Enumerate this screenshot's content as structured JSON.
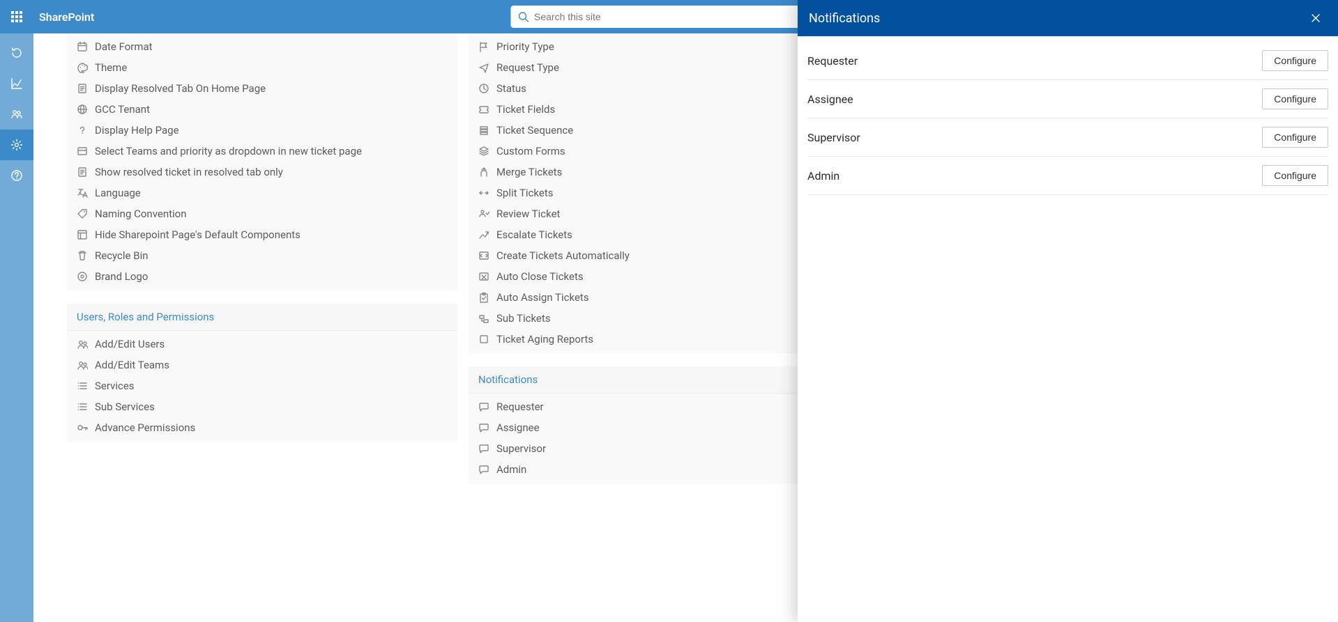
{
  "header": {
    "brand": "SharePoint",
    "search_placeholder": "Search this site"
  },
  "panel": {
    "title": "Notifications",
    "rows": [
      {
        "label": "Requester",
        "action": "Configure"
      },
      {
        "label": "Assignee",
        "action": "Configure"
      },
      {
        "label": "Supervisor",
        "action": "Configure"
      },
      {
        "label": "Admin",
        "action": "Configure"
      }
    ]
  },
  "left_column": {
    "general_items": [
      "Date Format",
      "Theme",
      "Display Resolved Tab On Home Page",
      "GCC Tenant",
      "Display Help Page",
      "Select Teams and priority as dropdown in new ticket page",
      "Show resolved ticket in resolved tab only",
      "Language",
      "Naming Convention",
      "Hide Sharepoint Page's Default Components",
      "Recycle Bin",
      "Brand Logo"
    ],
    "users_header": "Users, Roles and Permissions",
    "users_items": [
      "Add/Edit Users",
      "Add/Edit Teams",
      "Services",
      "Sub Services",
      "Advance Permissions"
    ]
  },
  "right_column": {
    "ticket_items": [
      "Priority Type",
      "Request Type",
      "Status",
      "Ticket Fields",
      "Ticket Sequence",
      "Custom Forms",
      "Merge Tickets",
      "Split Tickets",
      "Review Ticket",
      "Escalate Tickets",
      "Create Tickets Automatically",
      "Auto Close Tickets",
      "Auto Assign Tickets",
      "Sub Tickets",
      "Ticket Aging Reports"
    ],
    "notifications_header": "Notifications",
    "notifications_items": [
      "Requester",
      "Assignee",
      "Supervisor",
      "Admin"
    ]
  }
}
